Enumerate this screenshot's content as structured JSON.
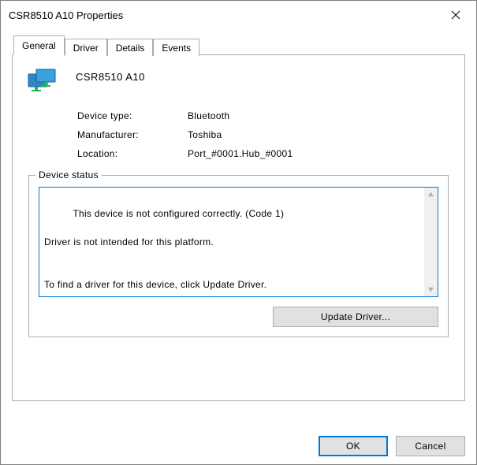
{
  "window": {
    "title": "CSR8510 A10 Properties"
  },
  "tabs": {
    "general": "General",
    "driver": "Driver",
    "details": "Details",
    "events": "Events"
  },
  "device": {
    "name": "CSR8510 A10",
    "type_label": "Device type:",
    "type_value": "Bluetooth",
    "manufacturer_label": "Manufacturer:",
    "manufacturer_value": "Toshiba",
    "location_label": "Location:",
    "location_value": "Port_#0001.Hub_#0001"
  },
  "status": {
    "legend": "Device status",
    "text": "This device is not configured correctly. (Code 1)\n\nDriver is not intended for this platform.\n\n\nTo find a driver for this device, click Update Driver."
  },
  "buttons": {
    "update_driver": "Update Driver...",
    "ok": "OK",
    "cancel": "Cancel"
  }
}
